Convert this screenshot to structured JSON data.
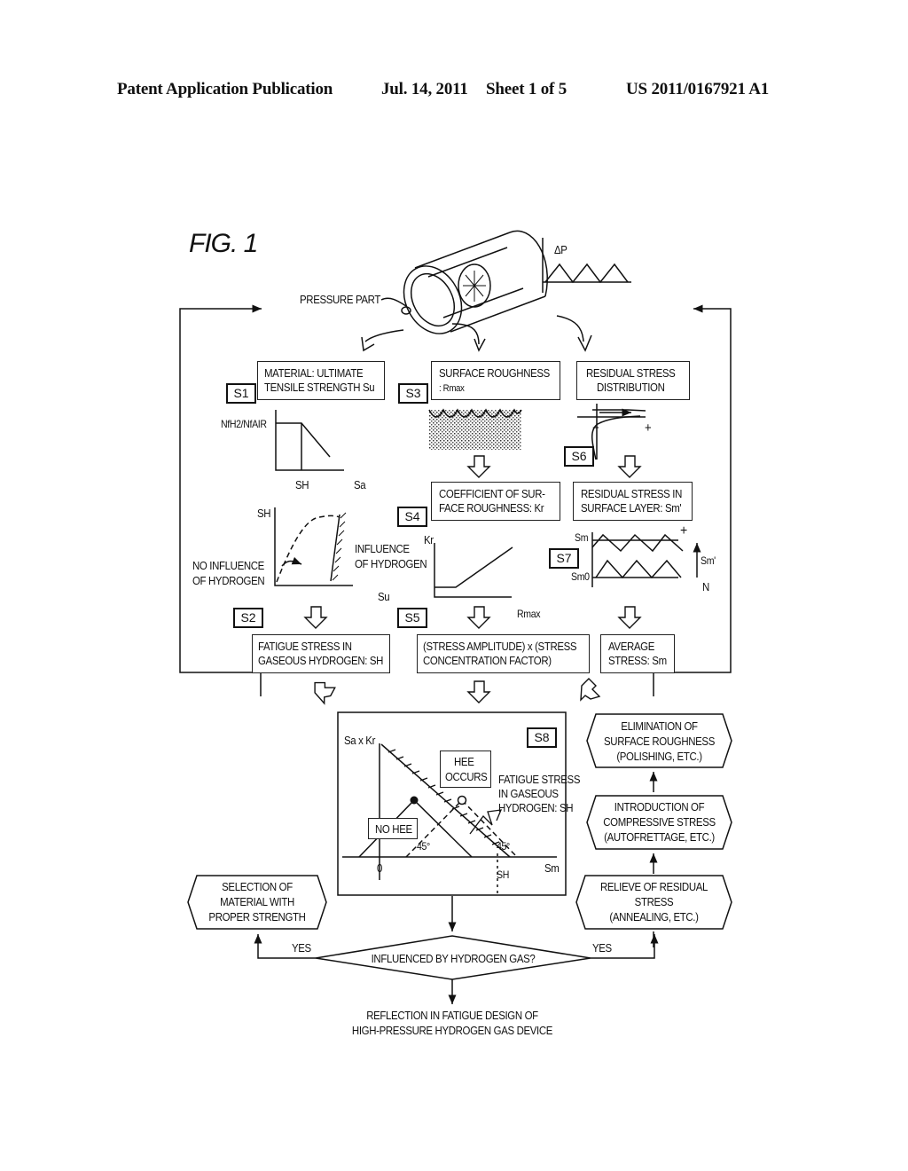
{
  "header": {
    "publication": "Patent Application Publication",
    "date": "Jul. 14, 2011",
    "sheet": "Sheet 1 of 5",
    "number": "US 2011/0167921 A1"
  },
  "figure": {
    "label": "FIG. 1",
    "pressure_part": "PRESSURE PART",
    "delta_p": "ΔP"
  },
  "steps": {
    "s1": "S1",
    "s2": "S2",
    "s3": "S3",
    "s4": "S4",
    "s5": "S5",
    "s6": "S6",
    "s7": "S7",
    "s8": "S8"
  },
  "boxes": {
    "material": [
      "MATERIAL: ULTIMATE",
      "TENSILE STRENGTH Su"
    ],
    "surface": [
      "SURFACE ROUGHNESS",
      ": Rmax"
    ],
    "residual": [
      "RESIDUAL STRESS",
      "DISTRIBUTION"
    ],
    "coeff": [
      "COEFFICIENT OF SUR-",
      "FACE ROUGHNESS: Kr"
    ],
    "residual_surface": [
      "RESIDUAL STRESS IN",
      "SURFACE LAYER: Sm'"
    ],
    "fatigue": [
      "FATIGUE STRESS IN",
      "GASEOUS HYDROGEN: SH"
    ],
    "amplitude": [
      "(STRESS AMPLITUDE) x (STRESS",
      "CONCENTRATION FACTOR)"
    ],
    "average": [
      "AVERAGE",
      "STRESS: Sm"
    ]
  },
  "graphs": {
    "s1": {
      "ylabel": "NfH2/NfAIR",
      "x_mark": "SH",
      "xlabel": "Sa"
    },
    "s2": {
      "ylabel": "SH",
      "xlabel": "Su",
      "no_influence": [
        "NO INFLUENCE",
        "OF HYDROGEN"
      ],
      "influence": [
        "INFLUENCE",
        "OF HYDROGEN"
      ]
    },
    "s4": {
      "ylabel": "Kr",
      "xlabel": "Rmax"
    },
    "s6": {
      "minus": "−",
      "plus": "+"
    },
    "s7": {
      "sm": "Sm",
      "sm0": "Sm0",
      "sm_prime": "Sm'",
      "n": "N",
      "plus": "+"
    },
    "s8": {
      "ylabel": "Sa x Kr",
      "xlabel": "Sm",
      "origin": "0",
      "sh": "SH",
      "hee_occurs": [
        "HEE",
        "OCCURS"
      ],
      "no_hee": "NO HEE",
      "angle1": "45°",
      "angle2": "45°",
      "fatigue_label": [
        "FATIGUE STRESS",
        "IN GASEOUS",
        "HYDROGEN: SH"
      ]
    }
  },
  "remedies": {
    "elimination": [
      "ELIMINATION OF",
      "SURFACE ROUGHNESS",
      "(POLISHING, ETC.)"
    ],
    "introduction": [
      "INTRODUCTION OF",
      "COMPRESSIVE STRESS",
      "(AUTOFRETTAGE, ETC.)"
    ],
    "relieve": [
      "RELIEVE OF RESIDUAL",
      "STRESS",
      "(ANNEALING, ETC.)"
    ],
    "selection": [
      "SELECTION OF",
      "MATERIAL WITH",
      "PROPER STRENGTH"
    ]
  },
  "decision": {
    "question": "INFLUENCED BY HYDROGEN GAS?",
    "yes_left": "YES",
    "yes_right": "YES"
  },
  "result": [
    "REFLECTION IN FATIGUE DESIGN OF",
    "HIGH-PRESSURE HYDROGEN GAS DEVICE"
  ]
}
